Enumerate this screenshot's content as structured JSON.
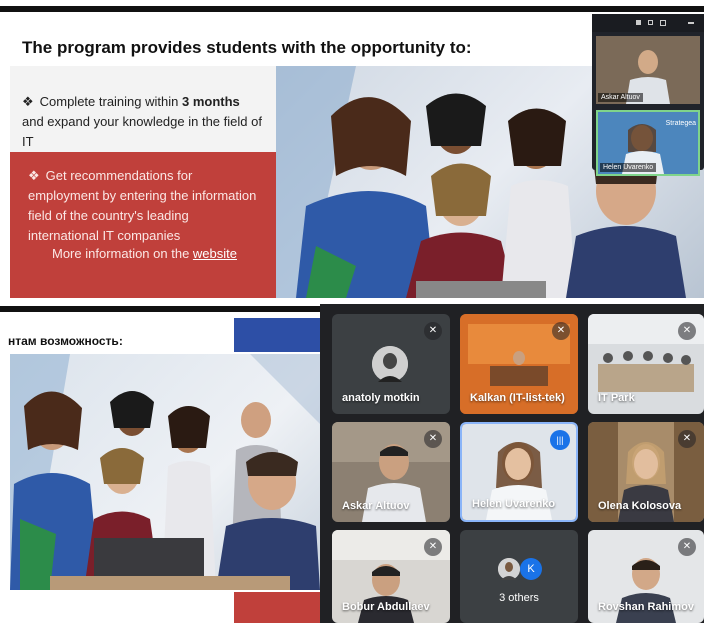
{
  "top_slide": {
    "title": "The program provides students with the opportunity to:",
    "bullet1": {
      "pre": "Complete training within ",
      "bold": "3 months",
      "post": " and expand your knowledge in the field of IT"
    },
    "bullet2": "Get recommendations for employment by entering the information field of the country's leading international IT companies",
    "more_text": "More information on the ",
    "more_link": "website",
    "bullet_symbol": "❖"
  },
  "mini_meeting": {
    "tile1_name": "Askar Altuov",
    "tile2_name": "Helen Uvarenko",
    "tile2_overlay": "Strategea"
  },
  "bottom_slide": {
    "title": "нтам возможность:"
  },
  "meeting_tiles": [
    {
      "name": "anatoly motkin",
      "muted": true,
      "kind": "avatar"
    },
    {
      "name": "Kalkan (IT-list-tek)",
      "muted": true,
      "kind": "video"
    },
    {
      "name": "IT Park",
      "muted": true,
      "kind": "video"
    },
    {
      "name": "Askar Altuov",
      "muted": true,
      "kind": "video"
    },
    {
      "name": "Helen Uvarenko",
      "muted": false,
      "kind": "video",
      "speaking": true
    },
    {
      "name": "Olena Kolosova",
      "muted": true,
      "kind": "video"
    },
    {
      "name": "Bobur Abdullaev",
      "muted": true,
      "kind": "video"
    },
    {
      "name": "3 others",
      "muted": false,
      "kind": "others",
      "avatar_letter": "K"
    },
    {
      "name": "Rovshan Rahimov",
      "muted": true,
      "kind": "video"
    }
  ],
  "colors": {
    "slide_red": "#c0403b",
    "slide_blue": "#2d4fa6",
    "meet_bg": "#202124",
    "tile_bg": "#3c4043",
    "speaking_border": "#8ab4f8"
  }
}
